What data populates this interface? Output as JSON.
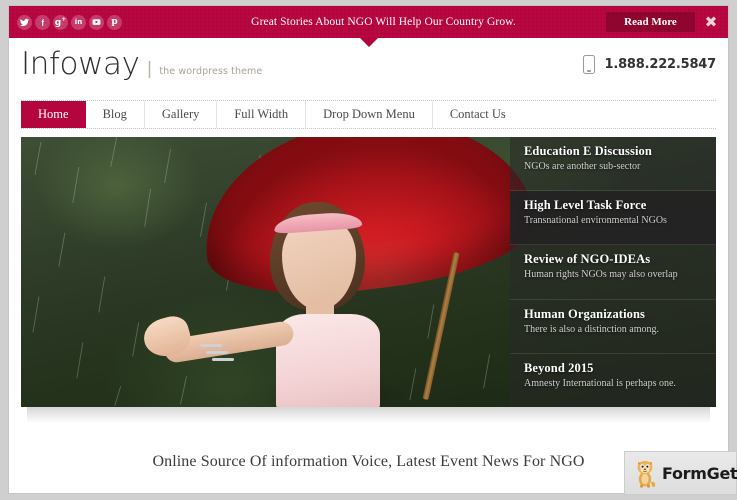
{
  "notification": {
    "message": "Great Stories About NGO Will Help Our Country Grow.",
    "read_more_label": "Read More",
    "close_label": "✖",
    "bg_color": "#b4053f",
    "button_color": "#8e0630",
    "social": [
      {
        "name": "twitter",
        "glyph": "t"
      },
      {
        "name": "facebook",
        "glyph": "f"
      },
      {
        "name": "google-plus",
        "glyph": "g"
      },
      {
        "name": "linkedin",
        "glyph": "in"
      },
      {
        "name": "youtube",
        "glyph": "yt"
      },
      {
        "name": "pinterest",
        "glyph": "p"
      }
    ]
  },
  "header": {
    "logo": "Infoway",
    "logo_separator": "|",
    "tagline": "the wordpress theme",
    "phone": "1.888.222.5847",
    "phone_icon": "mobile-phone-icon"
  },
  "nav": {
    "items": [
      {
        "label": "Home",
        "active": true
      },
      {
        "label": "Blog",
        "active": false
      },
      {
        "label": "Gallery",
        "active": false
      },
      {
        "label": "Full Width",
        "active": false
      },
      {
        "label": "Drop Down Menu",
        "active": false
      },
      {
        "label": "Contact Us",
        "active": false
      }
    ],
    "active_color": "#b4053f"
  },
  "slider": {
    "image_description": "Girl in pink dress holding a red umbrella in the rain",
    "items": [
      {
        "title": "Education E Discussion",
        "subtitle": "NGOs are another sub-sector",
        "active": false
      },
      {
        "title": "High Level Task Force",
        "subtitle": "Transnational environmental NGOs",
        "active": true
      },
      {
        "title": "Review of NGO-IDEAs",
        "subtitle": "Human rights NGOs may also overlap",
        "active": false
      },
      {
        "title": "Human Organizations",
        "subtitle": "There is also a distinction among.",
        "active": false
      },
      {
        "title": "Beyond 2015",
        "subtitle": "Amnesty International is perhaps one.",
        "active": false
      }
    ]
  },
  "bottom": {
    "tagline": "Online Source Of information Voice, Latest Event News For NGO"
  },
  "watermark": {
    "label": "FormGet",
    "mascot": "tiger-cub-mascot-icon"
  }
}
